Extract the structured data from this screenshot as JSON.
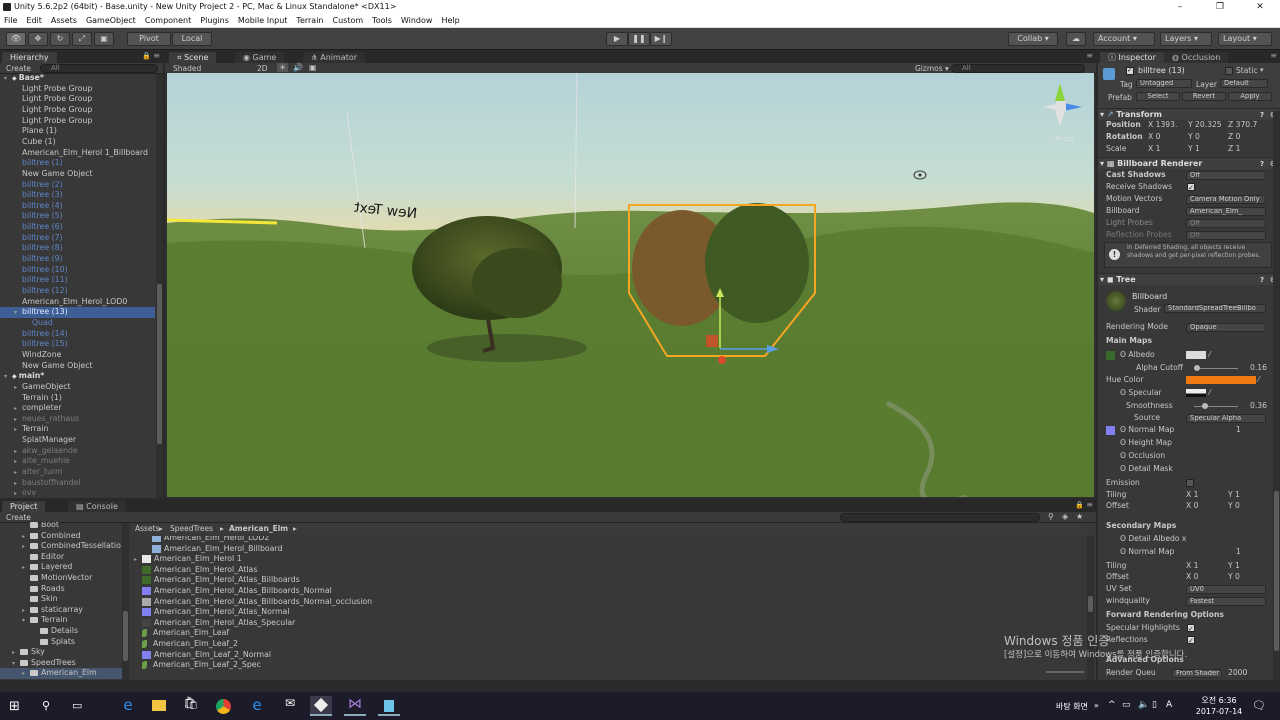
{
  "window": {
    "title": "Unity 5.6.2p2 (64bit) - Base.unity - New Unity Project 2 - PC, Mac & Linux Standalone* <DX11>",
    "controls": [
      "–",
      "❐",
      "✕"
    ]
  },
  "menu": [
    "File",
    "Edit",
    "Assets",
    "GameObject",
    "Component",
    "Plugins",
    "Mobile Input",
    "Terrain",
    "Custom",
    "Tools",
    "Window",
    "Help"
  ],
  "toolbar": {
    "pivot": "Pivot",
    "local": "Local",
    "collab": "Collab ▾",
    "account": "Account",
    "layers": "Layers",
    "layout": "Layout"
  },
  "hierarchy": {
    "tab": "Hierarchy",
    "create": "Create",
    "search": "All",
    "items": [
      {
        "label": "Base*",
        "style": "bold",
        "indent": 0,
        "tri": "▾"
      },
      {
        "label": "Light Probe Group",
        "style": "",
        "indent": 1
      },
      {
        "label": "Light Probe Group",
        "style": "",
        "indent": 1
      },
      {
        "label": "Light Probe Group",
        "style": "",
        "indent": 1
      },
      {
        "label": "Light Probe Group",
        "style": "",
        "indent": 1
      },
      {
        "label": "Plane (1)",
        "style": "",
        "indent": 1
      },
      {
        "label": "Cube (1)",
        "style": "",
        "indent": 1
      },
      {
        "label": "American_Elm_Herol 1_Billboard",
        "style": "",
        "indent": 1
      },
      {
        "label": "billtree (1)",
        "style": "blue",
        "indent": 1
      },
      {
        "label": "New Game Object",
        "style": "",
        "indent": 1
      },
      {
        "label": "billtree (2)",
        "style": "blue",
        "indent": 1
      },
      {
        "label": "billtree (3)",
        "style": "blue",
        "indent": 1
      },
      {
        "label": "billtree (4)",
        "style": "blue",
        "indent": 1
      },
      {
        "label": "billtree (5)",
        "style": "blue",
        "indent": 1
      },
      {
        "label": "billtree (6)",
        "style": "blue",
        "indent": 1
      },
      {
        "label": "billtree (7)",
        "style": "blue",
        "indent": 1
      },
      {
        "label": "billtree (8)",
        "style": "blue",
        "indent": 1
      },
      {
        "label": "billtree (9)",
        "style": "blue",
        "indent": 1
      },
      {
        "label": "billtree (10)",
        "style": "blue",
        "indent": 1
      },
      {
        "label": "billtree (11)",
        "style": "blue",
        "indent": 1
      },
      {
        "label": "billtree (12)",
        "style": "blue",
        "indent": 1
      },
      {
        "label": "American_Elm_Herol_LOD0",
        "style": "",
        "indent": 1
      },
      {
        "label": "billtree (13)",
        "style": "sel",
        "indent": 1,
        "tri": "▾"
      },
      {
        "label": "Quad",
        "style": "blue",
        "indent": 2
      },
      {
        "label": "billtree (14)",
        "style": "blue",
        "indent": 1
      },
      {
        "label": "billtree (15)",
        "style": "blue",
        "indent": 1
      },
      {
        "label": "WindZone",
        "style": "",
        "indent": 1
      },
      {
        "label": "New Game Object",
        "style": "",
        "indent": 1
      },
      {
        "label": "main*",
        "style": "bold",
        "indent": 0,
        "tri": "▾"
      },
      {
        "label": "GameObject",
        "style": "",
        "indent": 1,
        "tri": "▸"
      },
      {
        "label": "Terrain (1)",
        "style": "",
        "indent": 1
      },
      {
        "label": "completer",
        "style": "",
        "indent": 1,
        "tri": "▸"
      },
      {
        "label": "neues_rathaus",
        "style": "gray",
        "indent": 1,
        "tri": "▸"
      },
      {
        "label": "Terrain",
        "style": "",
        "indent": 1,
        "tri": "▸"
      },
      {
        "label": "SplatManager",
        "style": "",
        "indent": 1
      },
      {
        "label": "akw_gelaende",
        "style": "gray",
        "indent": 1,
        "tri": "▸"
      },
      {
        "label": "alte_muehle",
        "style": "gray",
        "indent": 1,
        "tri": "▸"
      },
      {
        "label": "alter_turm",
        "style": "gray",
        "indent": 1,
        "tri": "▸"
      },
      {
        "label": "baustoffhandel",
        "style": "gray",
        "indent": 1,
        "tri": "▸"
      },
      {
        "label": "ovv",
        "style": "gray",
        "indent": 1,
        "tri": "▸"
      }
    ]
  },
  "scene": {
    "tabs": [
      "Scene",
      "Game",
      "Animator"
    ],
    "shaded": "Shaded",
    "mode2d": "2D",
    "gizmos": "Gizmos ▾",
    "search": "All",
    "text3d": "New Text",
    "persp": "< Persp"
  },
  "inspector": {
    "tabs": [
      "Inspector",
      "Occlusion"
    ],
    "object_name": "billtree (13)",
    "static": "Static",
    "tag_label": "Tag",
    "tag": "Untagged",
    "layer_label": "Layer",
    "layer": "Default",
    "prefab_label": "Prefab",
    "prefab_buttons": [
      "Select",
      "Revert",
      "Apply"
    ],
    "transform": {
      "title": "Transform",
      "position": {
        "label": "Position",
        "x": "X 1393.",
        "y": "Y 20.325",
        "z": "Z 370.7"
      },
      "rotation": {
        "label": "Rotation",
        "x": "X 0",
        "y": "Y 0",
        "z": "Z 0"
      },
      "scale": {
        "label": "Scale",
        "x": "X 1",
        "y": "Y 1",
        "z": "Z 1"
      }
    },
    "billboard_renderer": {
      "title": "Billboard Renderer",
      "cast_shadows": {
        "label": "Cast Shadows",
        "value": "Off"
      },
      "receive_shadows": {
        "label": "Receive Shadows"
      },
      "motion_vectors": {
        "label": "Motion Vectors",
        "value": "Camera Motion Only"
      },
      "billboard": {
        "label": "Billboard",
        "value": "American_Elm_"
      },
      "light_probes": {
        "label": "Light Probes",
        "value": "Off"
      },
      "reflection_probes": {
        "label": "Reflection Probes",
        "value": "Off"
      },
      "note": "In Deferred Shading, all objects receive shadows and get per-pixel reflection probes."
    },
    "tree": {
      "title": "Tree",
      "material": "Billboard",
      "shader_label": "Shader",
      "shader": "StandardSpreadTreeBillbo",
      "rendering_mode": {
        "label": "Rendering Mode",
        "value": "Opaque"
      },
      "main_maps": "Main Maps",
      "albedo": "Albedo",
      "alpha_cutoff": {
        "label": "Alpha Cutoff",
        "value": "0.16"
      },
      "hue_color": "Hue Color",
      "specular": "Specular",
      "smoothness": {
        "label": "Smoothness",
        "value": "0.36"
      },
      "source": {
        "label": "Source",
        "value": "Specular Alpha"
      },
      "normal_map": {
        "label": "Normal Map",
        "value": "1"
      },
      "height_map": "Height Map",
      "occlusion": "Occlusion",
      "detail_mask": "Detail Mask",
      "emission": "Emission",
      "tiling": {
        "label": "Tiling",
        "x": "X 1",
        "y": "Y 1"
      },
      "offset": {
        "label": "Offset",
        "x": "X 0",
        "y": "Y 0"
      },
      "secondary_maps": "Secondary Maps",
      "detail_albedo": "Detail Albedo x",
      "normal_map2": {
        "label": "Normal Map",
        "value": "1"
      },
      "tiling2": {
        "label": "Tiling",
        "x": "X 1",
        "y": "Y 1"
      },
      "offset2": {
        "label": "Offset",
        "x": "X 0",
        "y": "Y 0"
      },
      "uv_set": {
        "label": "UV Set",
        "value": "UV0"
      },
      "windquality": {
        "label": "windquality",
        "value": "Fastest"
      },
      "forward_options": "Forward Rendering Options",
      "specular_highlights": "Specular Highlights",
      "reflections": "Reflections",
      "advanced": "Advanced Options",
      "render_queue": {
        "label": "Render Queu",
        "source": "From Shader",
        "value": "2000"
      }
    }
  },
  "project": {
    "tabs": [
      "Project",
      "Console"
    ],
    "create": "Create",
    "breadcrumb": [
      "Assets",
      "SpeedTrees",
      "American_Elm"
    ],
    "folders": [
      {
        "label": "Boot",
        "indent": 1
      },
      {
        "label": "Combined",
        "indent": 1,
        "tri": "▸"
      },
      {
        "label": "CombinedTessellatio",
        "indent": 1,
        "tri": "▸"
      },
      {
        "label": "Editor",
        "indent": 1
      },
      {
        "label": "Layered",
        "indent": 1,
        "tri": "▸"
      },
      {
        "label": "MotionVector",
        "indent": 1
      },
      {
        "label": "Roads",
        "indent": 1
      },
      {
        "label": "Skin",
        "indent": 1
      },
      {
        "label": "staticarray",
        "indent": 1,
        "tri": "▸"
      },
      {
        "label": "Terrain",
        "indent": 1,
        "tri": "▾"
      },
      {
        "label": "Details",
        "indent": 2
      },
      {
        "label": "Splats",
        "indent": 2
      },
      {
        "label": "Sky",
        "indent": 0,
        "tri": "▸"
      },
      {
        "label": "SpeedTrees",
        "indent": 0,
        "tri": "▾"
      },
      {
        "label": "American_Elm",
        "indent": 1,
        "tri": "▸",
        "sel": true
      }
    ],
    "assets": [
      {
        "label": "American_Elm_Herol_LOD2",
        "indent": 1,
        "icon": "mesh"
      },
      {
        "label": "American_Elm_Herol_Billboard",
        "indent": 1,
        "icon": "mesh"
      },
      {
        "label": "American_Elm_Herol 1",
        "indent": 0,
        "icon": "prefab",
        "tri": "▸"
      },
      {
        "label": "American_Elm_Herol_Atlas",
        "indent": 0,
        "icon": "tex-green"
      },
      {
        "label": "American_Elm_Herol_Atlas_Billboards",
        "indent": 0,
        "icon": "tex-green"
      },
      {
        "label": "American_Elm_Herol_Atlas_Billboards_Normal",
        "indent": 0,
        "icon": "tex-blue"
      },
      {
        "label": "American_Elm_Herol_Atlas_Billboards_Normal_occlusion",
        "indent": 0,
        "icon": "tex-grid"
      },
      {
        "label": "American_Elm_Herol_Atlas_Normal",
        "indent": 0,
        "icon": "tex-blue"
      },
      {
        "label": "American_Elm_Herol_Atlas_Specular",
        "indent": 0,
        "icon": "tex-dark"
      },
      {
        "label": "American_Elm_Leaf",
        "indent": 0,
        "icon": "leaf"
      },
      {
        "label": "American_Elm_Leaf_2",
        "indent": 0,
        "icon": "leaf"
      },
      {
        "label": "American_Elm_Leaf_2_Normal",
        "indent": 0,
        "icon": "tex-blue"
      },
      {
        "label": "American_Elm_Leaf_2_Spec",
        "indent": 0,
        "icon": "leaf"
      }
    ]
  },
  "watermark": {
    "line1": "Windows 정품 인증",
    "line2": "[설정]으로 이동하여 Windows를 정품 인증합니다."
  },
  "taskbar": {
    "desktop": "바탕 화면",
    "time": "오전 6:36",
    "date": "2017-07-14"
  },
  "colors": {
    "selection": "#3e5f96",
    "prefab_blue": "#5f86c8",
    "hue_color": "#f07a10",
    "scene_outline": "#f5a623"
  }
}
